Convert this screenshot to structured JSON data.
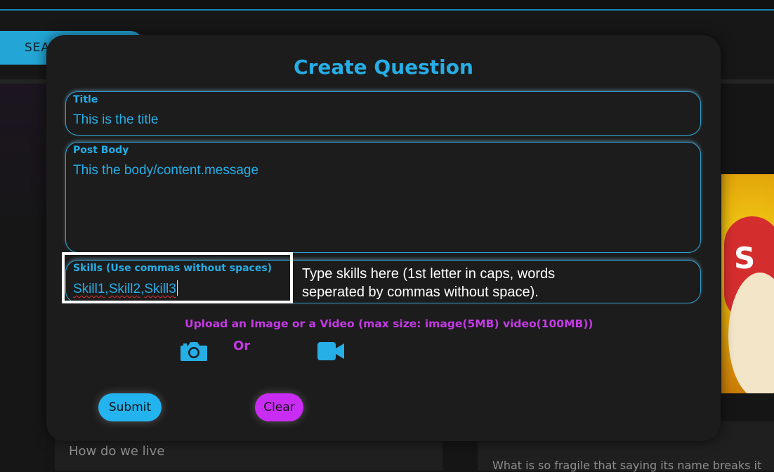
{
  "background": {
    "search_button_label": "SEA",
    "left_card_title": "How do we live",
    "right_card_title": "What is so fragile that saying its name breaks it"
  },
  "modal": {
    "title": "Create Question",
    "title_field": {
      "label": "Title",
      "value": "This is the title"
    },
    "body_field": {
      "label": "Post Body",
      "value": "This the body/content.message"
    },
    "skills_field": {
      "label": "Skills (Use commas without spaces)",
      "tokens": [
        "Skill1",
        "Skill2",
        "Skill3"
      ],
      "separator": ","
    },
    "annotation": {
      "line1": "Type skills here (1st letter in caps, words",
      "line2": "seperated by commas without space)."
    },
    "upload": {
      "text": "Upload an Image or a Video (max size: image(5MB) video(100MB))",
      "or_label": "Or",
      "image_icon": "camera-icon",
      "video_icon": "video-camera-icon"
    },
    "buttons": {
      "submit": "Submit",
      "clear": "Clear"
    }
  },
  "colors": {
    "accent": "#26aee6",
    "upload_purple": "#c43ae5",
    "submit_bg": "#23b4ef",
    "clear_bg": "#c92cf2",
    "modal_bg": "#1c1c1c"
  }
}
